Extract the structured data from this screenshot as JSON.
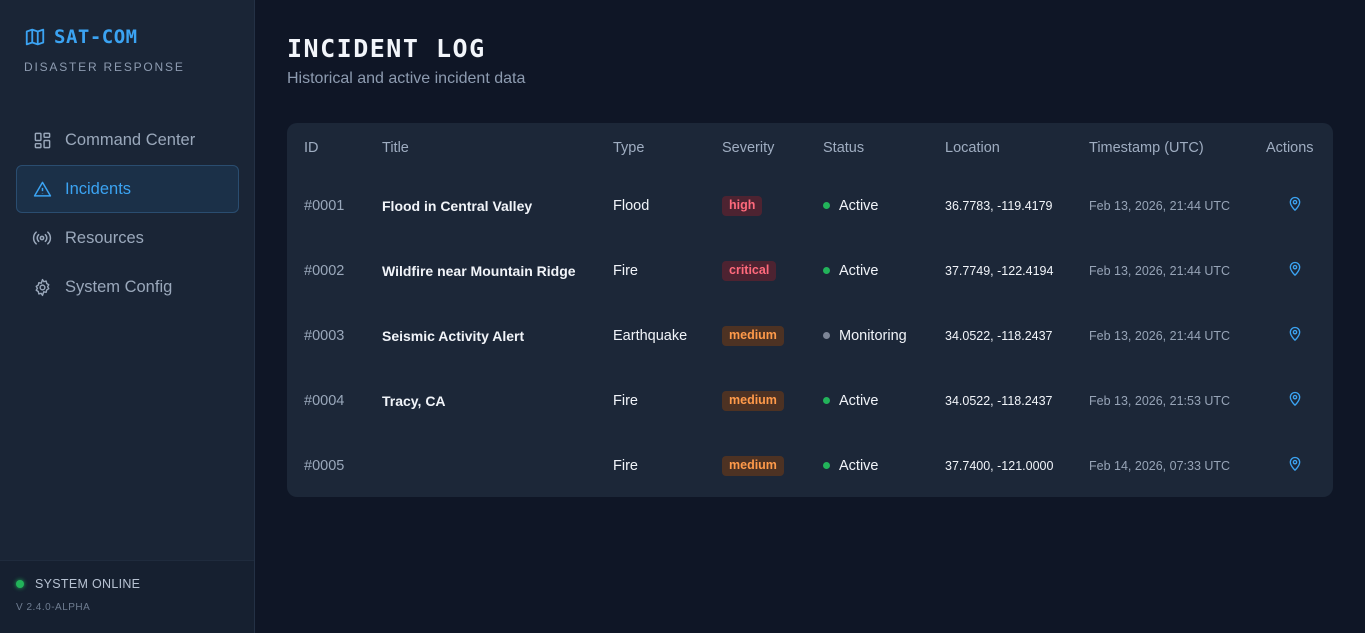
{
  "brand": {
    "name": "SAT-COM",
    "subtitle": "DISASTER RESPONSE",
    "accent": "#3ba3f2"
  },
  "sidebar": {
    "items": [
      {
        "label": "Command Center",
        "icon": "dashboard-grid-icon"
      },
      {
        "label": "Incidents",
        "icon": "warning-triangle-icon",
        "active": true
      },
      {
        "label": "Resources",
        "icon": "broadcast-icon"
      },
      {
        "label": "System Config",
        "icon": "gear-icon"
      }
    ],
    "status": "SYSTEM ONLINE",
    "version": "V 2.4.0-ALPHA"
  },
  "page": {
    "title": "INCIDENT LOG",
    "subtitle": "Historical and active incident data"
  },
  "table": {
    "columns": [
      "ID",
      "Title",
      "Type",
      "Severity",
      "Status",
      "Location",
      "Timestamp (UTC)",
      "Actions"
    ],
    "rows": [
      {
        "id": "#0001",
        "title": "Flood in Central Valley",
        "type": "Flood",
        "severity": "high",
        "status": "Active",
        "status_color": "green",
        "location": "36.7783, -119.4179",
        "timestamp": "Feb 13, 2026, 21:44 UTC"
      },
      {
        "id": "#0002",
        "title": "Wildfire near Mountain Ridge",
        "type": "Fire",
        "severity": "critical",
        "status": "Active",
        "status_color": "green",
        "location": "37.7749, -122.4194",
        "timestamp": "Feb 13, 2026, 21:44 UTC"
      },
      {
        "id": "#0003",
        "title": "Seismic Activity Alert",
        "type": "Earthquake",
        "severity": "medium",
        "status": "Monitoring",
        "status_color": "gray",
        "location": "34.0522, -118.2437",
        "timestamp": "Feb 13, 2026, 21:44 UTC"
      },
      {
        "id": "#0004",
        "title": "Tracy, CA",
        "type": "Fire",
        "severity": "medium",
        "status": "Active",
        "status_color": "green",
        "location": "34.0522, -118.2437",
        "timestamp": "Feb 13, 2026, 21:53 UTC"
      },
      {
        "id": "#0005",
        "title": "",
        "type": "Fire",
        "severity": "medium",
        "status": "Active",
        "status_color": "green",
        "location": "37.7400, -121.0000",
        "timestamp": "Feb 14, 2026, 07:33 UTC"
      }
    ],
    "action_icon": "map-pin-icon"
  }
}
